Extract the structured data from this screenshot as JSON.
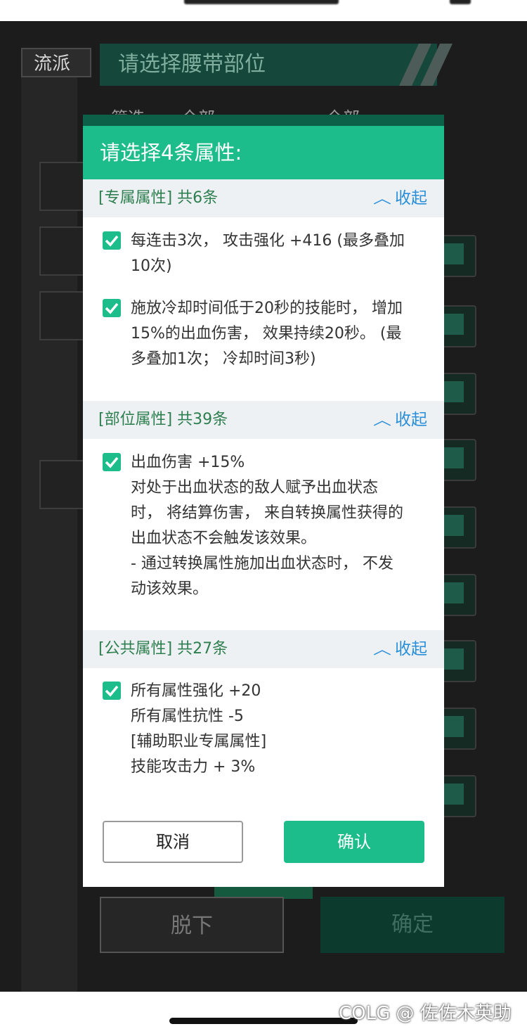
{
  "background": {
    "tag_label": "流派",
    "title": "请选择腰带部位",
    "filter_labels": [
      "筛选",
      "全部",
      "全部"
    ],
    "remove_label": "脱下",
    "confirm_label": "确定"
  },
  "dialog": {
    "title": "请选择4条属性:",
    "sections": [
      {
        "title": "[专属属性] 共6条",
        "collapse_label": "收起",
        "options": [
          {
            "checked": true,
            "lines": [
              "每连击3次， 攻击强化 +416 (最多叠加",
              "10次)"
            ]
          },
          {
            "checked": true,
            "lines": [
              "施放冷却时间低于20秒的技能时， 增加",
              "15%的出血伤害， 效果持续20秒。 (最",
              "多叠加1次； 冷却时间3秒)"
            ]
          }
        ]
      },
      {
        "title": "[部位属性] 共39条",
        "collapse_label": "收起",
        "options": [
          {
            "checked": true,
            "lines": [
              "出血伤害 +15%",
              "对处于出血状态的敌人赋予出血状态",
              "时， 将结算伤害， 来自转换属性获得的",
              "出血状态不会触发该效果。",
              "- 通过转换属性施加出血状态时， 不发",
              "动该效果。"
            ]
          }
        ]
      },
      {
        "title": "[公共属性] 共27条",
        "collapse_label": "收起",
        "options": [
          {
            "checked": true,
            "lines": [
              "所有属性强化 +20",
              "所有属性抗性 -5",
              "[辅助职业专属属性]",
              "技能攻击力 + 3%"
            ]
          }
        ]
      }
    ],
    "cancel_label": "取消",
    "confirm_label": "确认"
  },
  "watermark": "COLG @ 佐佐木英助",
  "colors": {
    "accent": "#1dbd8b",
    "section_title": "#2e7f4f",
    "collapse_link": "#2a8fd9",
    "section_bg": "#eef1f4"
  },
  "icons": {
    "checkbox": "checkbox-checked-icon",
    "collapse": "chevron-up-icon"
  }
}
